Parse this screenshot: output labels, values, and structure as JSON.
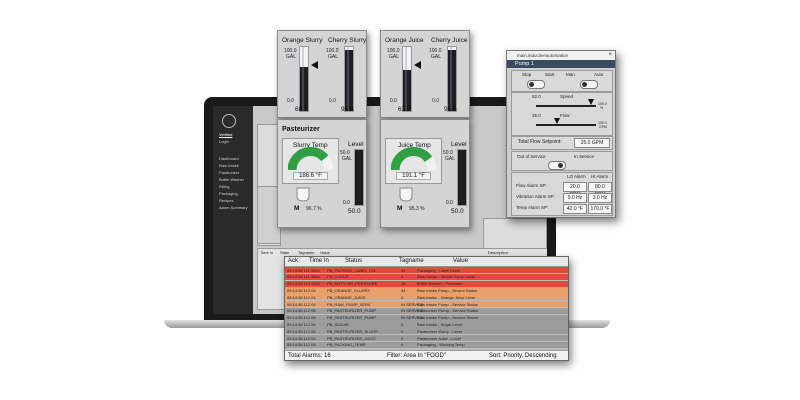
{
  "laptop": {
    "nav": {
      "items": [
        {
          "label": "Verified"
        },
        {
          "label": "Login"
        },
        {
          "label": "Dashboard"
        },
        {
          "label": "Raw Intake"
        },
        {
          "label": "Pasteurizer"
        },
        {
          "label": "Bottle Washer"
        },
        {
          "label": "Filling"
        },
        {
          "label": "Packaging"
        },
        {
          "label": "Recipes"
        },
        {
          "label": "Alarm Summary"
        }
      ]
    },
    "bg_cells": [
      "Time In",
      "State",
      "Tagname",
      "Value",
      "Description"
    ]
  },
  "tanks_left": {
    "tanks": [
      {
        "name": "Orange Slurry",
        "max": "100.0",
        "unit": "GAL",
        "min": "0.0",
        "value": "68.7",
        "level": 0.687
      },
      {
        "name": "Cherry Slurry",
        "max": "100.0",
        "unit": "GAL",
        "min": "0.0",
        "value": "95.6",
        "level": 0.956
      }
    ]
  },
  "tanks_right": {
    "tanks": [
      {
        "name": "Orange Juice",
        "max": "100.0",
        "unit": "GAL",
        "min": "0.0",
        "value": "63.9",
        "level": 0.639
      },
      {
        "name": "Cherry Juice",
        "max": "100.0",
        "unit": "GAL",
        "min": "0.0",
        "value": "95.6",
        "level": 0.956
      }
    ]
  },
  "pasteurizer_left": {
    "title": "Pasteurizer",
    "gauge_label": "Slurry Temp",
    "temp": "186.6 °F",
    "temp_level": 0.78,
    "level_label": "Level",
    "level_max": "50.0",
    "level_unit": "GAL",
    "level_min": "0.0",
    "level_value": "50.0",
    "level_fraction": 1.0,
    "mode": "M",
    "pump_pct": "96.7 %"
  },
  "pasteurizer_right": {
    "gauge_label": "Juice Temp",
    "temp": "191.1 °F",
    "temp_level": 0.8,
    "level_label": "Level",
    "level_max": "50.0",
    "level_unit": "GAL",
    "level_min": "0.0",
    "level_value": "50.0",
    "level_fraction": 1.0,
    "mode": "M",
    "pump_pct": "95.3 %"
  },
  "pump_window": {
    "window_title": "main.inductiveautomation",
    "header": "Pump 1",
    "stop_label": "Stop",
    "start_label": "Start",
    "man_label": "Man",
    "auto_label": "Auto",
    "speed_value": "92.0",
    "speed_label": "Speed",
    "speed_max": "100.0",
    "speed_unit": "%",
    "speed_fraction": 0.92,
    "flow_value": "35.0",
    "flow_label": "Flow",
    "flow_max": "100.0",
    "flow_unit": "GPM",
    "flow_fraction": 0.35,
    "total_flow_label": "Total Flow Setpoint:",
    "total_flow_value": "25.0 GPM",
    "out_of_service": "Out of Service",
    "in_service": "In Service",
    "lo_alarm": "LO Alarm",
    "hi_alarm": "HI Alarm",
    "alarms": [
      {
        "label": "Flow Alarm SP:",
        "lo": "20.0 GPM",
        "hi": "80.0 GPM"
      },
      {
        "label": "Vibration Alarm SP:",
        "lo": "9.0 Hz",
        "hi": "3.0 Hz"
      },
      {
        "label": "Temp Alarm SP:",
        "lo": "42.0 °F",
        "hi": "170.0 °F"
      }
    ]
  },
  "alarm_table": {
    "headers": {
      "ack": "Ack",
      "time": "Time In",
      "status": "Status",
      "tag": "Tagname",
      "value": "Value"
    },
    "rows": [
      {
        "time": "09:14:38 111 9664",
        "tag": "PB_PACKING_LABEL_LVL",
        "value": "44",
        "desc": "Packaging - Label Level",
        "color": "#e44a3c"
      },
      {
        "time": "09:14:38 111 9664",
        "tag": "PB_SYRUP",
        "value": "0",
        "desc": "Raw Intake - Simple Syrup Level",
        "color": "#e44a3c"
      },
      {
        "time": "09:14:38 112 9664",
        "tag": "PB_BOTTLER_PRESSURE",
        "value": "28",
        "desc": "Bottle Washer - Pressure",
        "color": "#e44a3c"
      },
      {
        "time": "09:14:38 112 04",
        "tag": "PB_ORANGE_SLURRY",
        "value": "54",
        "desc": "Raw Intake Pump - Severe Status",
        "color": "#e9a06a"
      },
      {
        "time": "09:14:38 112 04",
        "tag": "PB_ORANGE_JUICE",
        "value": "0",
        "desc": "Raw Intake - Orange Juice Level",
        "color": "#e9a06a"
      },
      {
        "time": "09:14:38 112 04",
        "tag": "PB_RAW_PUMP_SERV",
        "value": "IN SERVICE",
        "desc": "Raw Intake Pump - Service Status",
        "color": "#e9a06a"
      },
      {
        "time": "09:14:38 112 06",
        "tag": "PB_PASTEURIZER_PUMP",
        "value": "IN SERVICE",
        "desc": "Pasteurizer Pump - Service Status",
        "color": "#9c9c9c"
      },
      {
        "time": "09:14:38 112 06",
        "tag": "PB_PASTEURIZER_PUMP",
        "value": "IN SERVICE",
        "desc": "Raw Intake Pump - Service Status",
        "color": "#9c9c9c"
      },
      {
        "time": "09:14:38 112 06",
        "tag": "PB_SUGAR",
        "value": "0",
        "desc": "Raw Intake - Sugar Level",
        "color": "#9c9c9c"
      },
      {
        "time": "09:14:38 112 06",
        "tag": "PB_PASTEURIZER_SLURR",
        "value": "0",
        "desc": "Pasteurizer Slurry - Level",
        "color": "#9c9c9c"
      },
      {
        "time": "09:14:38 112 06",
        "tag": "PB_PASTEURIZER_JUICE",
        "value": "0",
        "desc": "Pasteurizer Juice - Level",
        "color": "#9c9c9c"
      },
      {
        "time": "09:14:38 112 06",
        "tag": "PB_PACKING_TEMP",
        "value": "0",
        "desc": "Packaging - Working Temp",
        "color": "#9c9c9c"
      }
    ],
    "footer_total": "Total Alarms: 16",
    "footer_filter": "Filter: Area In \"FOOD\"",
    "footer_sort": "Sort: Priority, Descending"
  },
  "colors": {
    "gauge_green": "#2ea043",
    "alarm_red": "#e44a3c",
    "alarm_orange": "#e9a06a"
  }
}
